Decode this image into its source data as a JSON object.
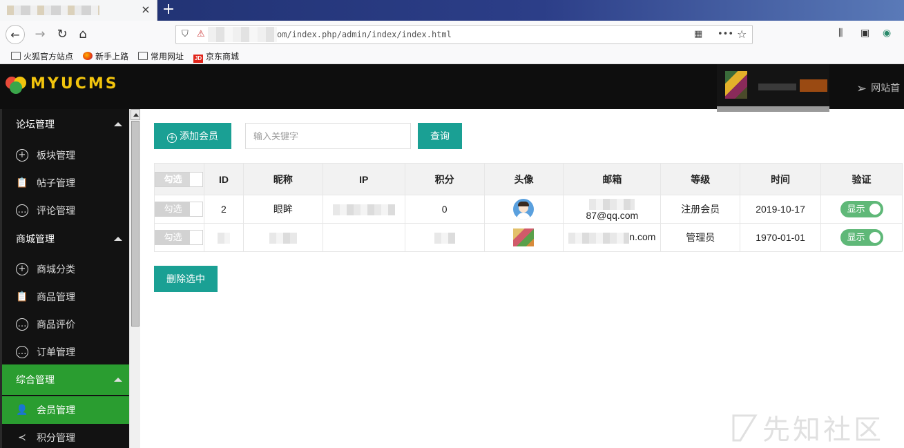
{
  "browser": {
    "tab_close": "×",
    "new_tab": "+",
    "url_text": "om/index.php/admin/index/index.html",
    "bookmarks": [
      "火狐官方站点",
      "新手上路",
      "常用网址",
      "京东商城"
    ],
    "jd_badge": "JD"
  },
  "header": {
    "logo_text": "MYUCMS",
    "site_home": "网站首"
  },
  "sidebar": {
    "groups": [
      {
        "title": "论坛管理",
        "items": [
          "板块管理",
          "帖子管理",
          "评论管理"
        ]
      },
      {
        "title": "商城管理",
        "items": [
          "商城分类",
          "商品管理",
          "商品评价",
          "订单管理"
        ]
      },
      {
        "title": "综合管理",
        "items": [
          "会员管理",
          "积分管理"
        ]
      }
    ],
    "active_item": "会员管理"
  },
  "toolbar": {
    "add_label": "添加会员",
    "search_placeholder": "输入关键字",
    "query_label": "查询",
    "delete_label": "删除选中"
  },
  "table": {
    "check_label": "勾选",
    "headers": [
      "ID",
      "昵称",
      "IP",
      "积分",
      "头像",
      "邮箱",
      "等级",
      "时间",
      "验证"
    ],
    "rows": [
      {
        "id": "2",
        "nickname": "眼眸",
        "points": "0",
        "email_suffix": "87@qq.com",
        "level": "注册会员",
        "time": "2019-10-17",
        "verify": "显示"
      },
      {
        "email_suffix": "n.com",
        "level": "管理员",
        "time": "1970-01-01",
        "verify": "显示"
      }
    ]
  },
  "watermark": "先知社区",
  "colors": {
    "accent": "#1aa094",
    "active_green": "#2a9d30",
    "toggle_green": "#5fb878",
    "logo_yellow": "#f2c40d"
  }
}
